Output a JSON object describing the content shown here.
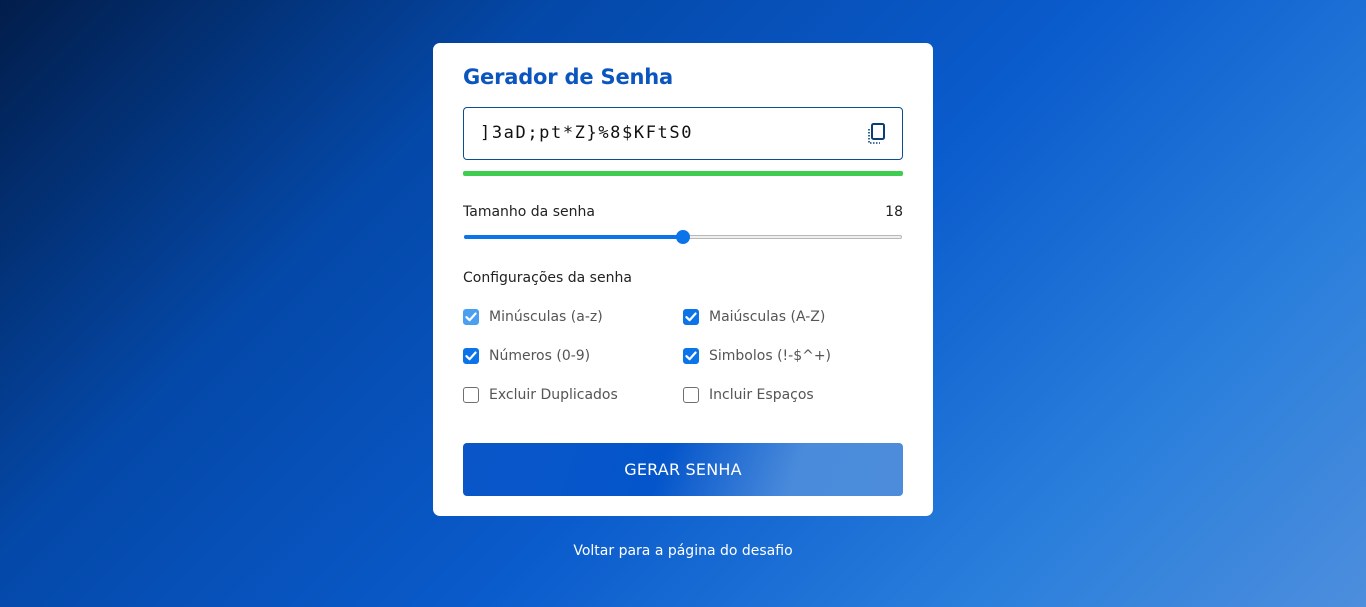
{
  "app": {
    "title": "Gerador de Senha"
  },
  "password": {
    "value": "]3aD;pt*Z}%8$KFtS0",
    "copy_icon": "copy-icon",
    "strength_fraction": 1.0,
    "strength_color": "#3fcd4f"
  },
  "length": {
    "label": "Tamanho da senha",
    "value": "18",
    "min": 4,
    "max": 32,
    "current": 18,
    "accent": "#0b74e8"
  },
  "settings": {
    "label": "Configurações da senha",
    "options": [
      {
        "label": "Minúsculas (a-z)",
        "checked": true
      },
      {
        "label": "Maiúsculas (A-Z)",
        "checked": true
      },
      {
        "label": "Números (0-9)",
        "checked": true
      },
      {
        "label": "Simbolos (!-$^+)",
        "checked": true
      },
      {
        "label": "Excluir Duplicados",
        "checked": false
      },
      {
        "label": "Incluir Espaços",
        "checked": false
      }
    ]
  },
  "actions": {
    "generate_label": "GERAR SENHA"
  },
  "footer": {
    "back_link": "Voltar para a página do desafio"
  }
}
